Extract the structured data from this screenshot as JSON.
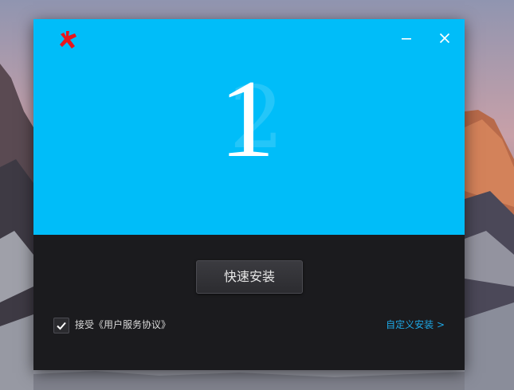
{
  "installer": {
    "step_number": "1",
    "step_number_ghost": "2",
    "install_button_label": "快速安装",
    "agree_checked": true,
    "agree_label": "接受《用户服务协议》",
    "custom_install_label": "自定义安装 >",
    "colors": {
      "accent_panel": "#00bdf9",
      "dark_panel": "#1b1b1e",
      "logo": "#e8151c",
      "link": "#1ea8e6"
    },
    "icons": [
      "app-logo-icon",
      "minimize-icon",
      "close-icon",
      "checkmark-icon"
    ]
  }
}
